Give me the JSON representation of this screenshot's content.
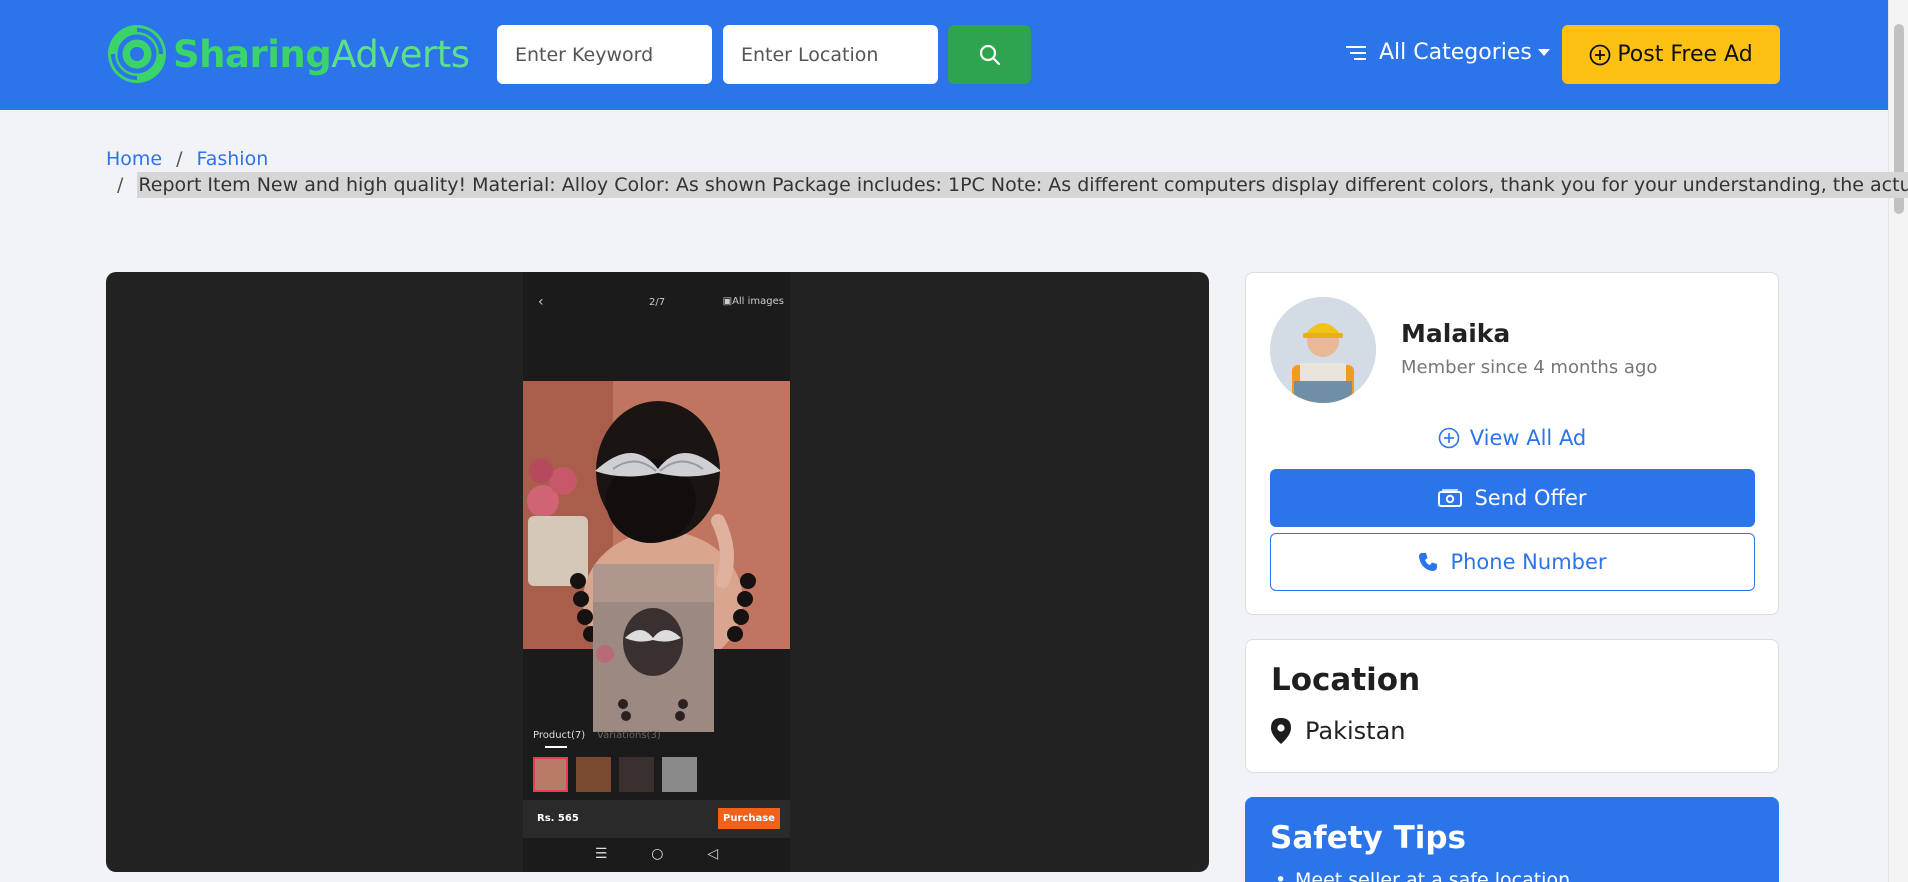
{
  "header": {
    "logo": {
      "part1": "Sharing",
      "part2": "Adverts"
    },
    "keyword_placeholder": "Enter Keyword",
    "location_placeholder": "Enter Location",
    "categories_label": "All Categories",
    "post_ad_label": "Post Free Ad"
  },
  "breadcrumb": {
    "home": "Home",
    "separator": "/",
    "category": "Fashion",
    "current": "Report Item New and high quality! Material: Alloy Color: As shown Package includes: 1PC Note: As different computers display different colors, thank you for your understanding, the actual"
  },
  "gallery": {
    "counter": "2/7",
    "all_images": "All images",
    "tab_product": "Product(7)",
    "tab_variations": "Variations(3)",
    "price": "Rs. 565",
    "purchase": "Purchase"
  },
  "seller": {
    "name": "Malaika",
    "member_since": "Member since 4 months ago",
    "view_all": "View All Ad",
    "send_offer": "Send Offer",
    "phone": "Phone Number"
  },
  "location": {
    "title": "Location",
    "place": "Pakistan"
  },
  "safety": {
    "title": "Safety Tips",
    "tip1": "Meet seller at a safe location"
  },
  "colors": {
    "primary": "#2b74ea",
    "logo_green": "#3bd46a",
    "search_green": "#2ea44f",
    "post_yellow": "#fdc114"
  }
}
